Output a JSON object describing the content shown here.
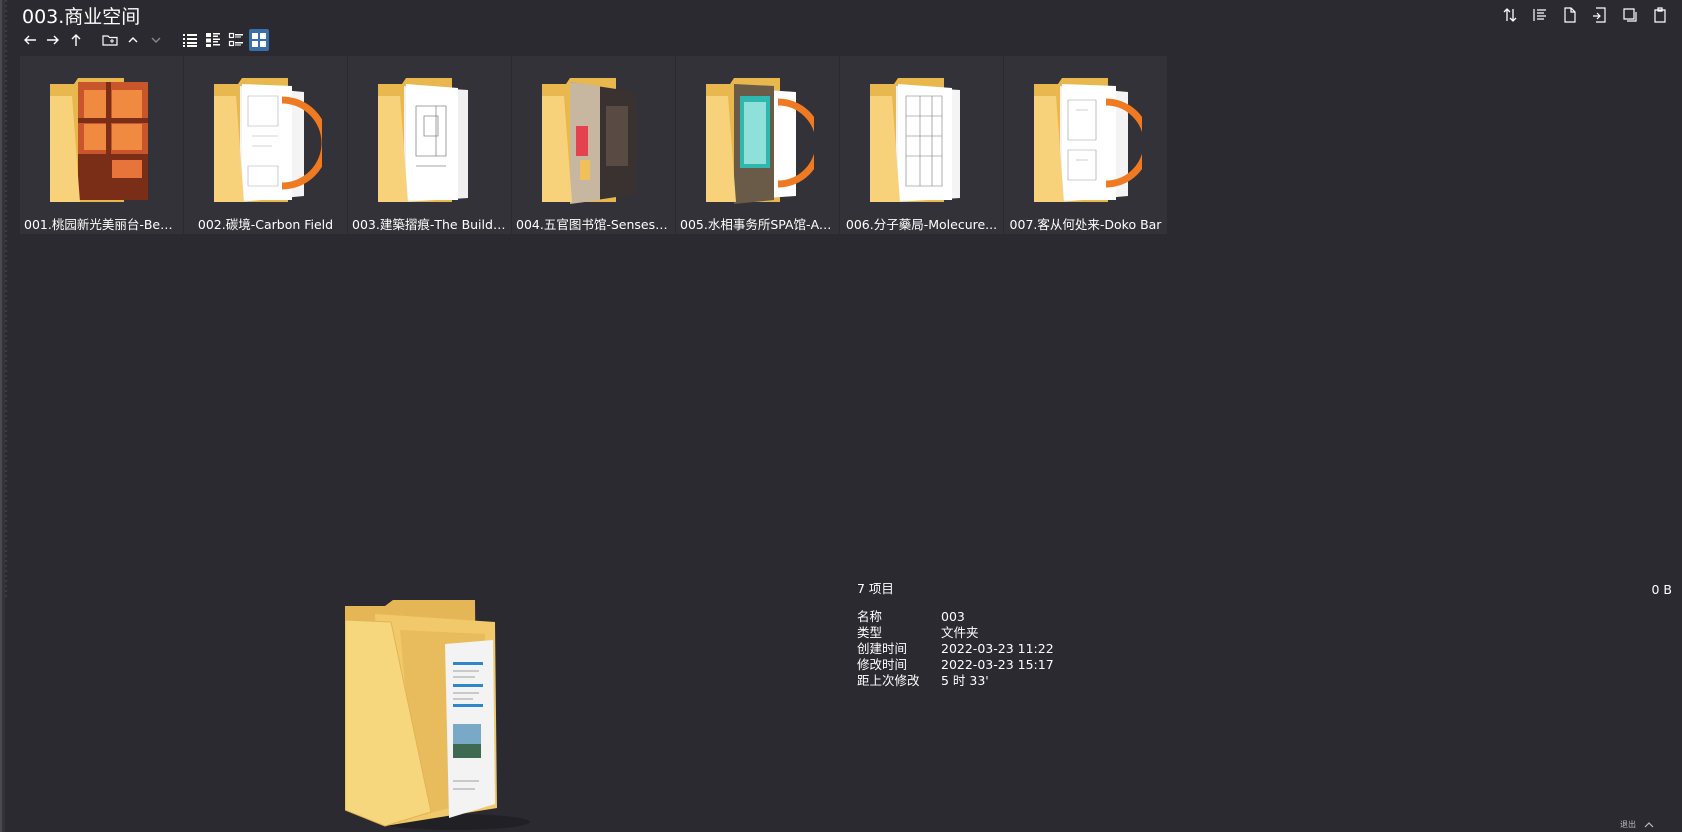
{
  "window": {
    "title": "003.商业空间"
  },
  "nav_toolbar": {
    "buttons": [
      "back-arrow-icon",
      "forward-arrow-icon",
      "up-arrow-icon",
      "new-folder-icon",
      "chevron-up-icon",
      "chevron-down-icon"
    ],
    "views": [
      "list-view-icon",
      "details-view-icon",
      "tiles-view-icon",
      "thumbnail-view-icon"
    ],
    "active_view": "thumbnail-view-icon"
  },
  "right_toolbar": {
    "buttons": [
      "sort-icon",
      "properties-list-icon",
      "file-icon",
      "file-move-icon",
      "copy-icon",
      "clipboard-icon"
    ]
  },
  "items": [
    {
      "name": "001.桃园新光美丽台-Beau...",
      "thumb_style": "orange-grid"
    },
    {
      "name": "002.碳境-Carbon Field",
      "thumb_style": "plan-orange"
    },
    {
      "name": "003.建築摺痕-The Buildin...",
      "thumb_style": "plan-gray"
    },
    {
      "name": "004.五官图书馆-Senses Li...",
      "thumb_style": "dark-photo"
    },
    {
      "name": "005.水相事务所SPA馆-Aq...",
      "thumb_style": "teal-photo"
    },
    {
      "name": "006.分子藥局-Molecure...",
      "thumb_style": "plan-gray"
    },
    {
      "name": "007.客从何处来-Doko Bar",
      "thumb_style": "plan-orange"
    }
  ],
  "details": {
    "count": "7 项目",
    "size": "0 B",
    "rows": [
      {
        "label": "名称",
        "value": "003"
      },
      {
        "label": "类型",
        "value": "文件夹"
      },
      {
        "label": "创建时间",
        "value": "2022-03-23  11:22"
      },
      {
        "label": "修改时间",
        "value": "2022-03-23  15:17"
      },
      {
        "label": "距上次修改",
        "value": "5 时 33'"
      }
    ]
  },
  "corner_text": "退出",
  "colors": {
    "background": "#2a2a30",
    "tile": "#323238",
    "folder": "#f5cf6e",
    "accent_orange": "#f07a22",
    "active_view": "#3a6fa8"
  }
}
